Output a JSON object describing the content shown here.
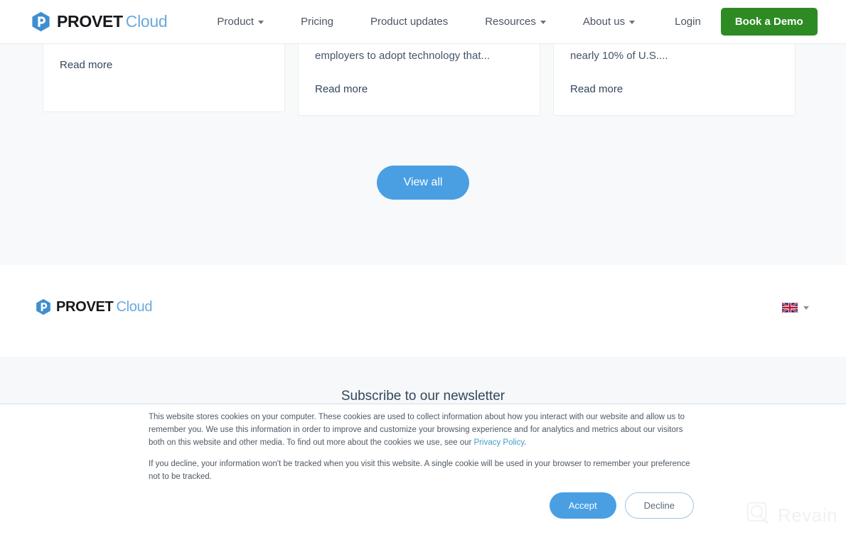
{
  "brand": {
    "name_bold": "PROVET",
    "name_light": "Cloud",
    "logo_icon": "provet-hexagon-p-logo",
    "accent_blue": "#4a9fe3",
    "logo_blue": "#6aa9dd",
    "cta_green": "#2e8b23",
    "link_teal": "#3f9ec4"
  },
  "header": {
    "nav": [
      {
        "label": "Product",
        "has_dropdown": true
      },
      {
        "label": "Pricing",
        "has_dropdown": false
      },
      {
        "label": "Product updates",
        "has_dropdown": false
      },
      {
        "label": "Resources",
        "has_dropdown": true
      },
      {
        "label": "About us",
        "has_dropdown": true
      }
    ],
    "login_label": "Login",
    "demo_label": "Book a Demo"
  },
  "articles": {
    "cards": [
      {
        "excerpt": "",
        "read_more": "Read more"
      },
      {
        "excerpt": "employers to adopt technology that...",
        "read_more": "Read more"
      },
      {
        "excerpt": "nearly 10% of U.S....",
        "read_more": "Read more"
      }
    ],
    "view_all_label": "View all"
  },
  "footer": {
    "language": {
      "flag_icon": "uk-flag-icon",
      "caret_icon": "chevron-down-icon"
    },
    "newsletter_title": "Subscribe to our newsletter"
  },
  "cookie_banner": {
    "paragraph_1_before_link": "This website stores cookies on your computer. These cookies are used to collect information about how you interact with our website and allow us to remember you. We use this information in order to improve and customize your browsing experience and for analytics and metrics about our visitors both on this website and other media. To find out more about the cookies we use, see our ",
    "privacy_policy_link": "Privacy Policy",
    "paragraph_1_after_link": ".",
    "paragraph_2": "If you decline, your information won't be tracked when you visit this website. A single cookie will be used in your browser to remember your preference not to be tracked.",
    "accept_label": "Accept",
    "decline_label": "Decline"
  },
  "watermark": {
    "text": "Revain",
    "icon": "revain-logo-icon"
  }
}
